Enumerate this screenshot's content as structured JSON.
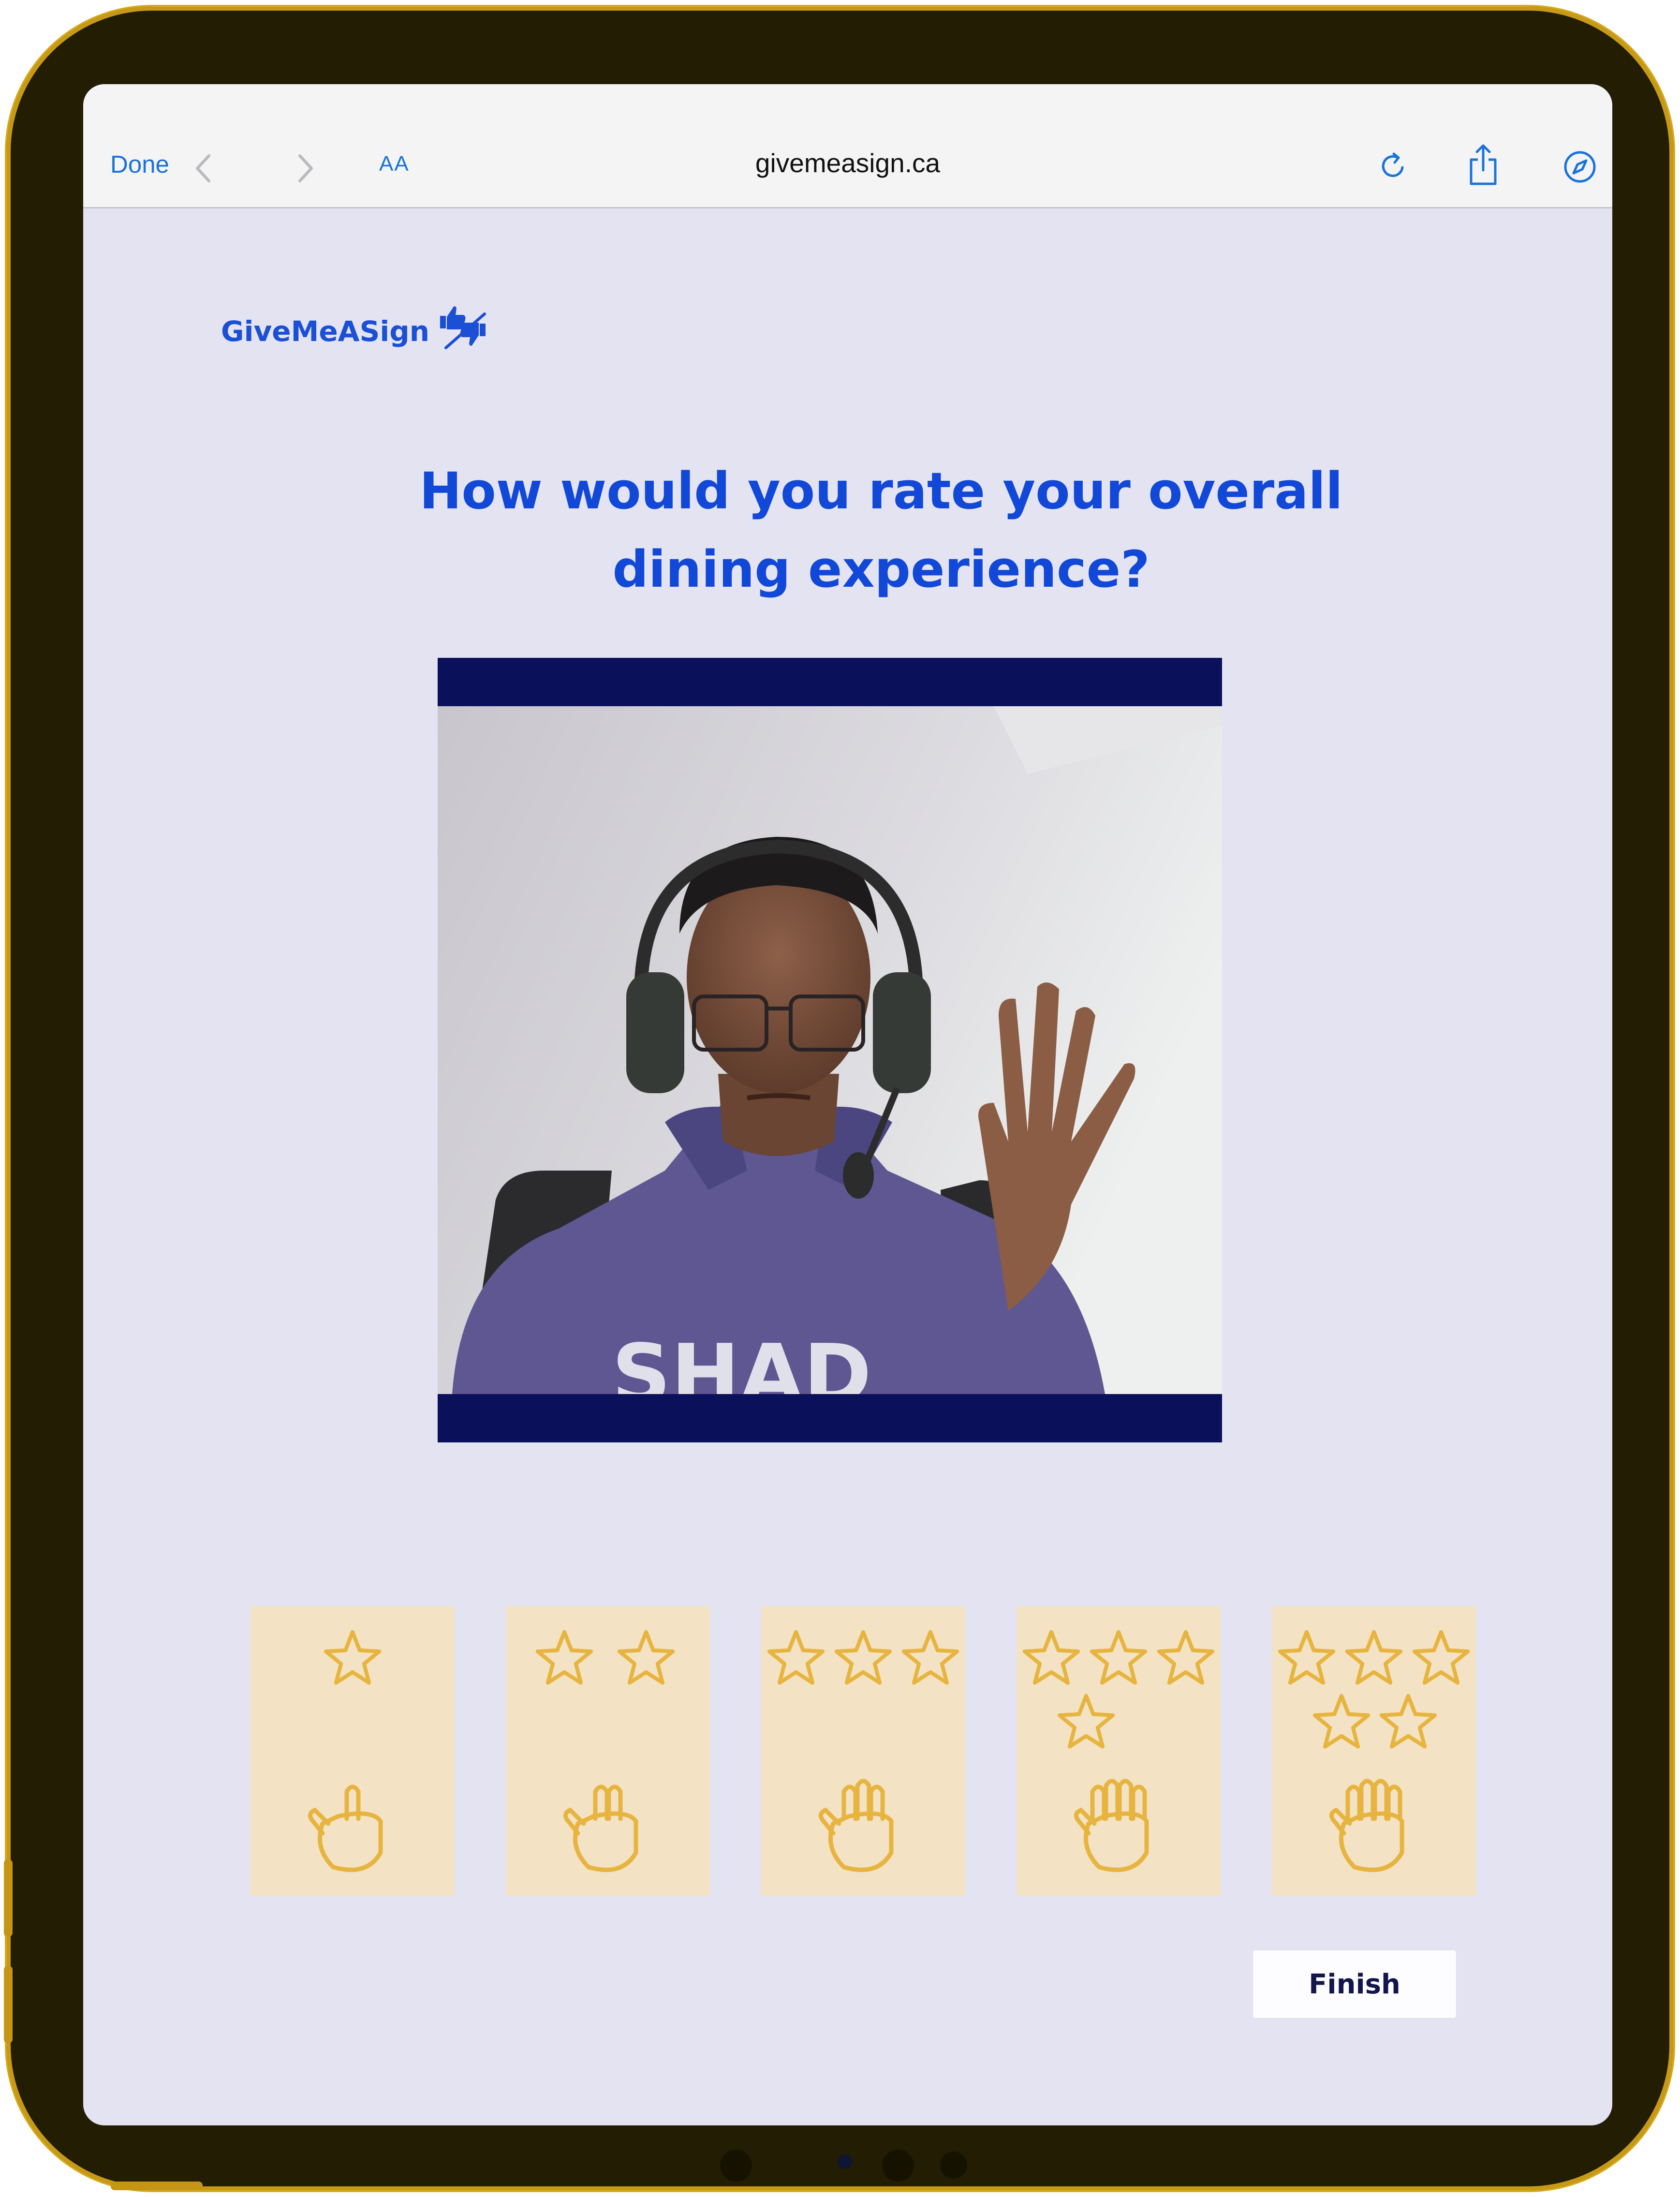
{
  "browser": {
    "done_label": "Done",
    "url": "givemeasign.ca",
    "text_size_label": "AA",
    "icons": [
      "back-chevron-icon",
      "forward-chevron-icon",
      "reload-icon",
      "share-icon",
      "compass-icon"
    ]
  },
  "page": {
    "logo_text": "GiveMeASign",
    "logo_icon": "thumbs-up-down-icon",
    "question": "How would you rate your overall dining experience?",
    "video": {
      "icon": "camera-feed",
      "shirt_text": "SHAD"
    },
    "rating_options": [
      {
        "stars": 1,
        "hand_icon": "one-finger-hand-icon"
      },
      {
        "stars": 2,
        "hand_icon": "two-finger-hand-icon"
      },
      {
        "stars": 3,
        "hand_icon": "three-finger-hand-icon"
      },
      {
        "stars": 4,
        "hand_icon": "four-finger-hand-icon"
      },
      {
        "stars": 5,
        "hand_icon": "five-finger-hand-icon"
      }
    ],
    "finish_label": "Finish"
  },
  "colors": {
    "accent": "#1148d8",
    "page_background": "#e3e3f2",
    "card_background": "#f3e3c4",
    "star_color": "#e7b43f",
    "video_bar": "#0a105a",
    "device_frame": "#221d03"
  }
}
